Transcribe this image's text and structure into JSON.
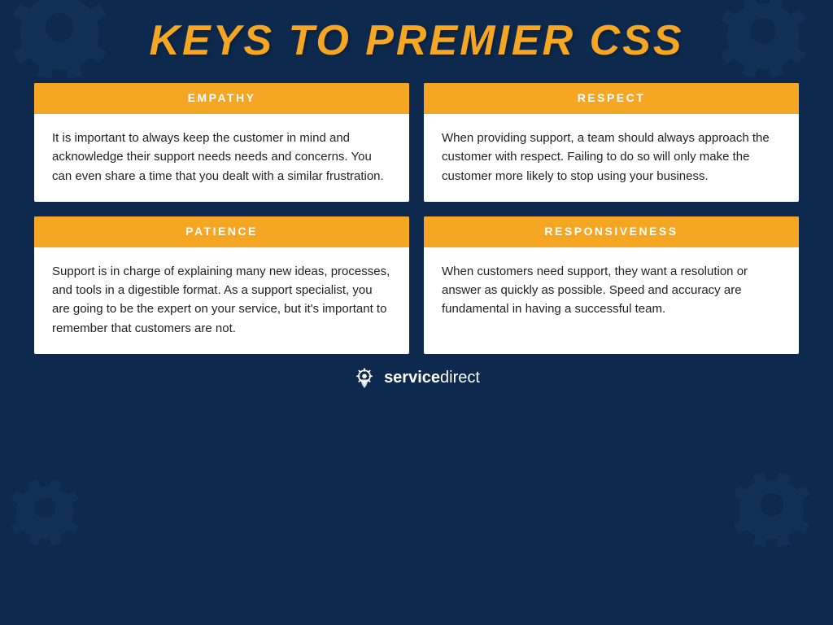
{
  "page": {
    "background_color": "#0d2a4e",
    "title": "KEYS TO PREMIER CSS"
  },
  "cards": [
    {
      "id": "empathy",
      "header": "EMPATHY",
      "body": "It is important to always keep the customer in mind and acknowledge their support needs needs and concerns. You can even share a time that you dealt with a similar frustration."
    },
    {
      "id": "respect",
      "header": "RESPECT",
      "body": "When providing support, a team should always approach the customer with respect. Failing to do so will only make the customer more likely to stop using your business."
    },
    {
      "id": "patience",
      "header": "PATIENCE",
      "body": "Support is in charge of explaining many new ideas, processes, and tools in a digestible format. As a support specialist, you are going to be the expert on your service, but it's important to remember that customers are not."
    },
    {
      "id": "responsiveness",
      "header": "RESPONSIVENESS",
      "body": "When customers need support, they want a resolution or answer as quickly as possible. Speed and accuracy are fundamental in having a successful team."
    }
  ],
  "footer": {
    "brand_bold": "service",
    "brand_light": "direct"
  }
}
